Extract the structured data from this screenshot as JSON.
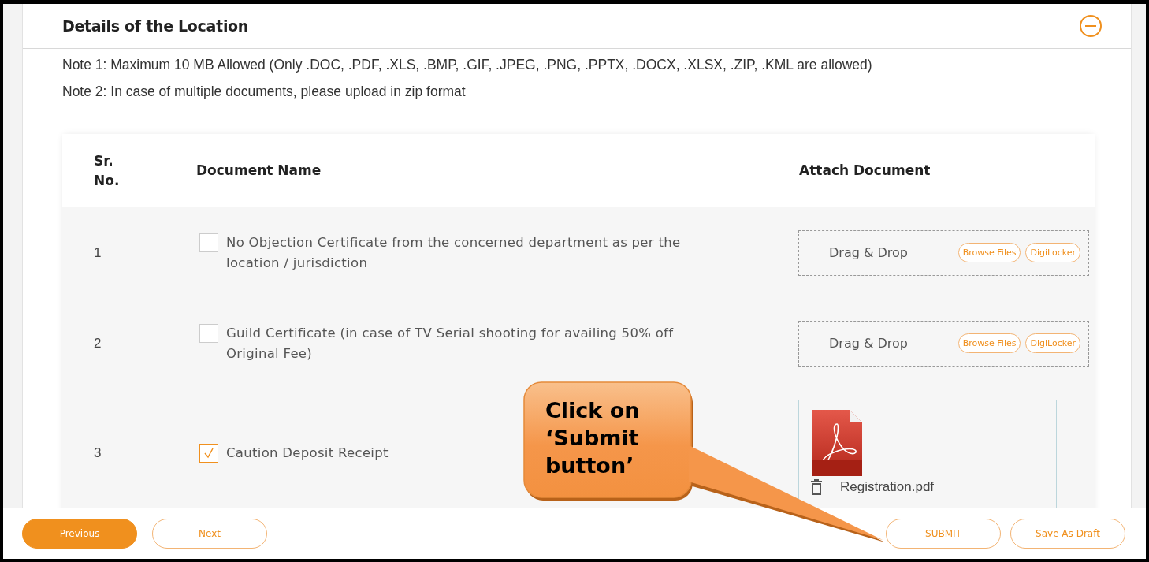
{
  "section": {
    "title": "Details of the Location",
    "expanded": true
  },
  "notes": [
    "Note 1: Maximum 10 MB Allowed (Only .DOC, .PDF, .XLS, .BMP, .GIF, .JPEG, .PNG, .PPTX, .DOCX, .XLSX, .ZIP, .KML are allowed)",
    "Note 2: In case of multiple documents, please upload in zip format"
  ],
  "table": {
    "columns": [
      "Sr. No.",
      "Document Name",
      "Attach Document"
    ],
    "rows": [
      {
        "sr": "1",
        "document": "No Objection Certificate from the concerned department as per the location / jurisdiction",
        "checked": false,
        "attachment": {
          "kind": "dropzone",
          "label": "Drag & Drop",
          "buttons": [
            "Browse Files",
            "DigiLocker"
          ]
        }
      },
      {
        "sr": "2",
        "document": "Guild Certificate (in case of TV Serial shooting for availing 50% off Original Fee)",
        "checked": false,
        "attachment": {
          "kind": "dropzone",
          "label": "Drag & Drop",
          "buttons": [
            "Browse Files",
            "DigiLocker"
          ]
        }
      },
      {
        "sr": "3",
        "document": "Caution Deposit Receipt",
        "checked": true,
        "attachment": {
          "kind": "file",
          "file_name": "Registration.pdf"
        }
      }
    ]
  },
  "footer": {
    "left_buttons": [
      {
        "label": "Previous",
        "primary": true
      },
      {
        "label": "Next",
        "primary": false
      }
    ],
    "right_buttons": [
      {
        "label": "SUBMIT",
        "primary": false
      },
      {
        "label": "Save As Draft",
        "primary": false
      }
    ]
  },
  "callout": {
    "text": "Click on ‘Submit button’"
  }
}
